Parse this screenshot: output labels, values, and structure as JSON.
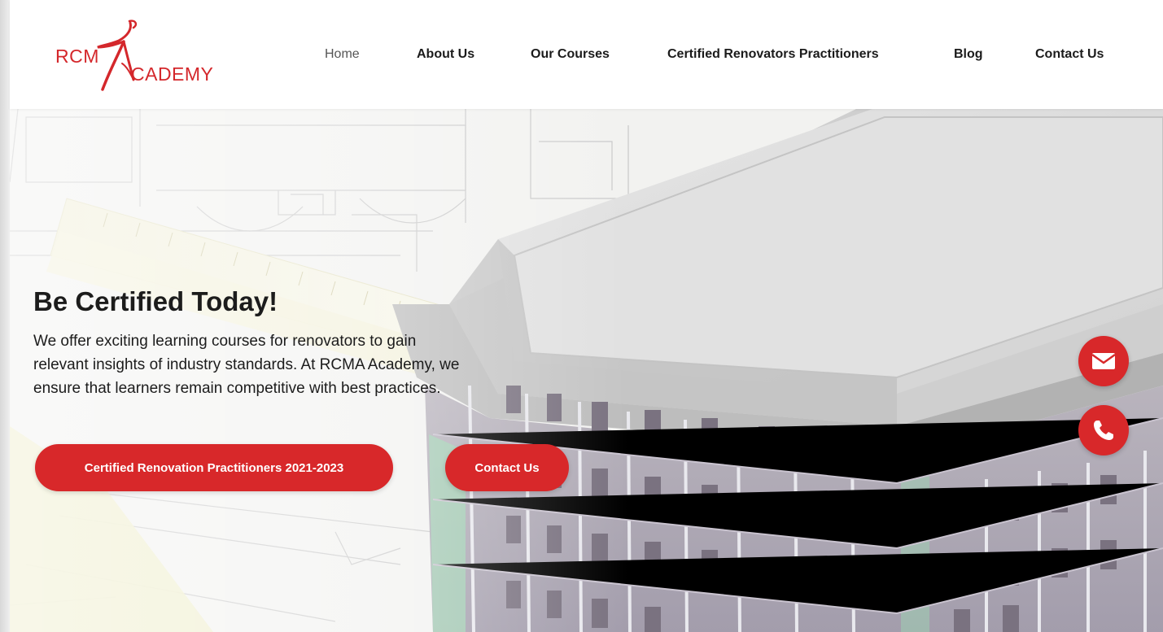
{
  "brand": {
    "logo_text_a": "RCM",
    "logo_text_b": "CADEMY",
    "logo_icon": "dancer-swoosh-icon",
    "accent": "#d8282a"
  },
  "nav": {
    "items": [
      {
        "label": "Home",
        "active": true
      },
      {
        "label": "About Us",
        "active": false
      },
      {
        "label": "Our Courses",
        "active": false
      },
      {
        "label": "Certified Renovators Practitioners",
        "active": false
      },
      {
        "label": "Blog",
        "active": false
      },
      {
        "label": "Contact Us",
        "active": false
      }
    ]
  },
  "hero": {
    "title": "Be Certified Today!",
    "lines": [
      "We offer exciting learning courses for renovators to gain",
      "relevant insights of industry standards. At RCMA Academy, we",
      "ensure that learners remain competitive with best practices."
    ],
    "primary_button": "Certified Renovation Practitioners 2021-2023",
    "secondary_button": "Contact Us"
  },
  "floating": {
    "mail_icon": "envelope-icon",
    "phone_icon": "phone-icon"
  }
}
